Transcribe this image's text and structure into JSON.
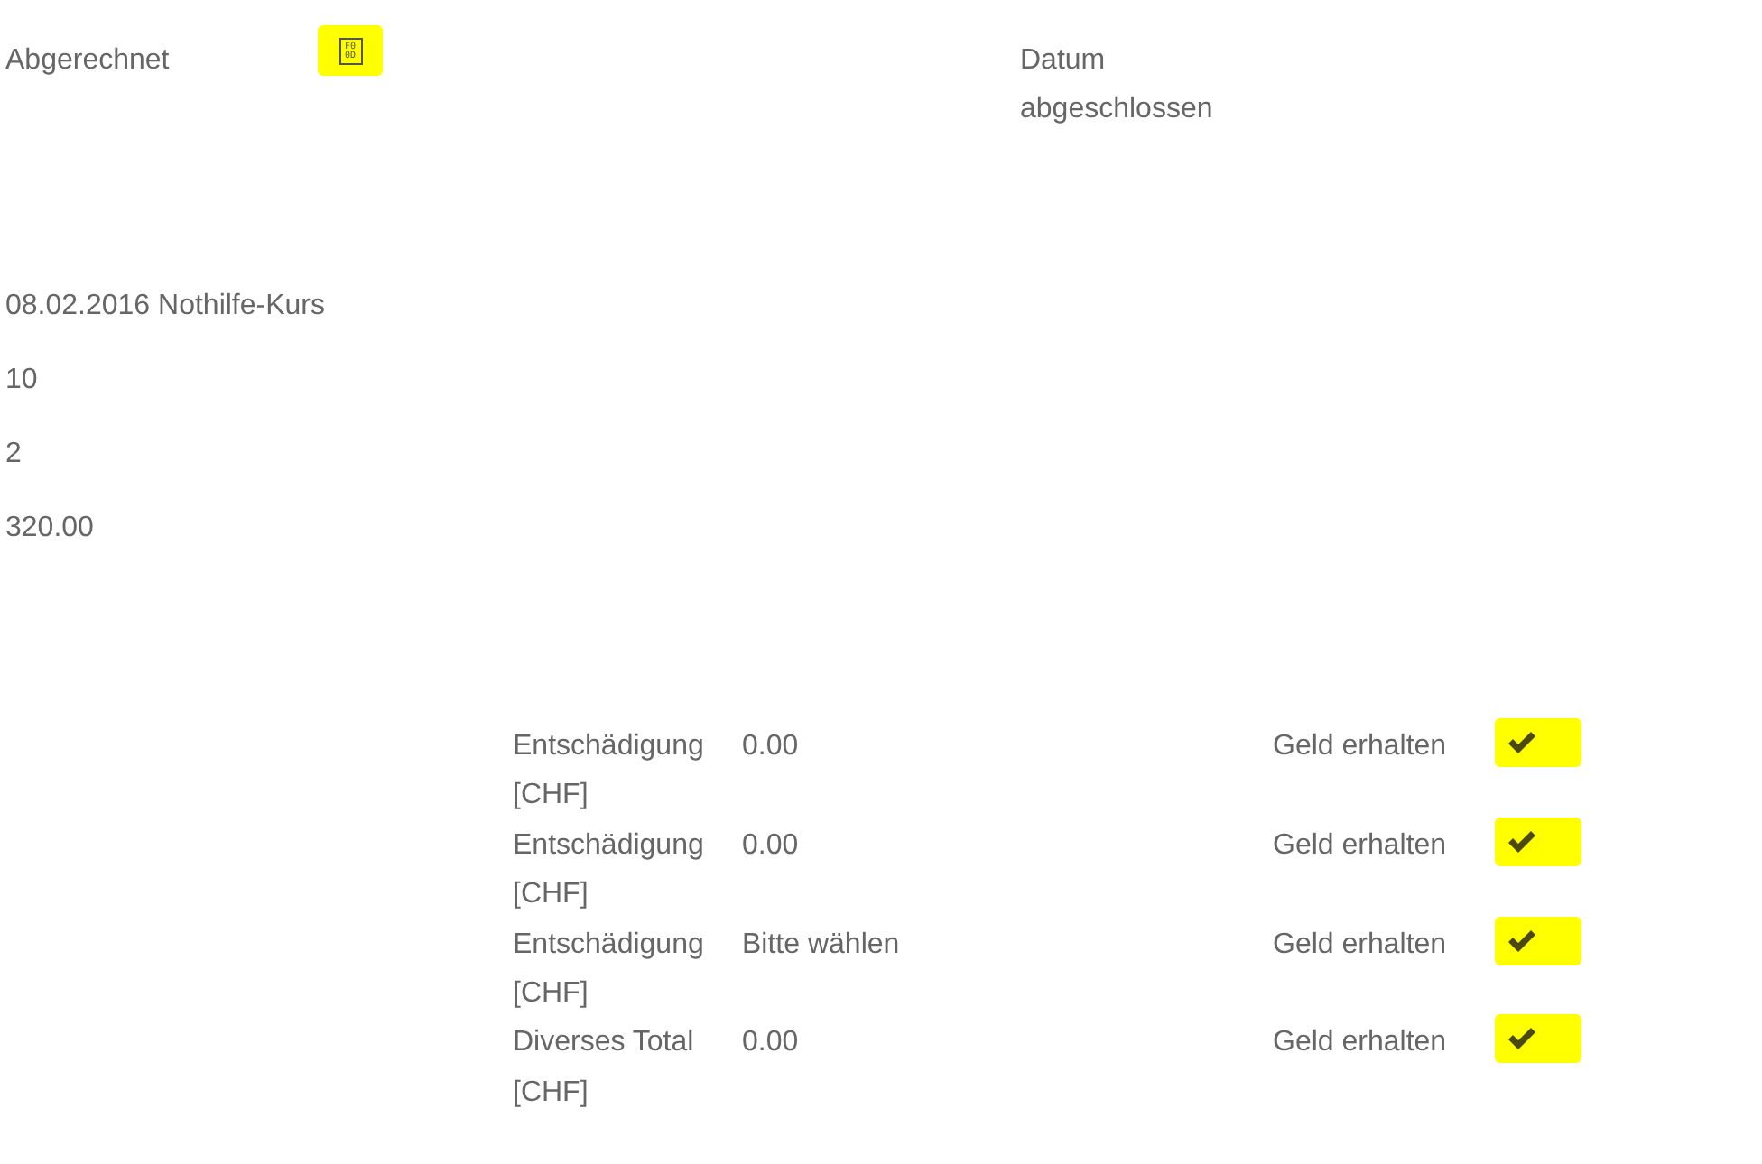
{
  "header": {
    "billed": {
      "label": "Abgerechnet",
      "glyph": "F0 0D",
      "highlighted": true
    },
    "date_label": "Datum abgeschlossen"
  },
  "course": {
    "title": "08.02.2016 Nothilfe-Kurs",
    "lines": [
      "10",
      "2",
      "320.00"
    ]
  },
  "payments": [
    {
      "label": "Entschädigung [CHF]",
      "value": "0.00",
      "status": "Geld erhalten",
      "checked": true,
      "highlighted": true
    },
    {
      "label": "Entschädigung [CHF]",
      "value": "0.00",
      "status": "Geld erhalten",
      "checked": true,
      "highlighted": true
    },
    {
      "label": "Entschädigung [CHF]",
      "value": "Bitte wählen",
      "status": "Geld erhalten",
      "checked": true,
      "highlighted": true
    },
    {
      "label": "Diverses Total [CHF]",
      "value": "0.00",
      "status": "Geld erhalten",
      "checked": true,
      "highlighted": true
    }
  ]
}
